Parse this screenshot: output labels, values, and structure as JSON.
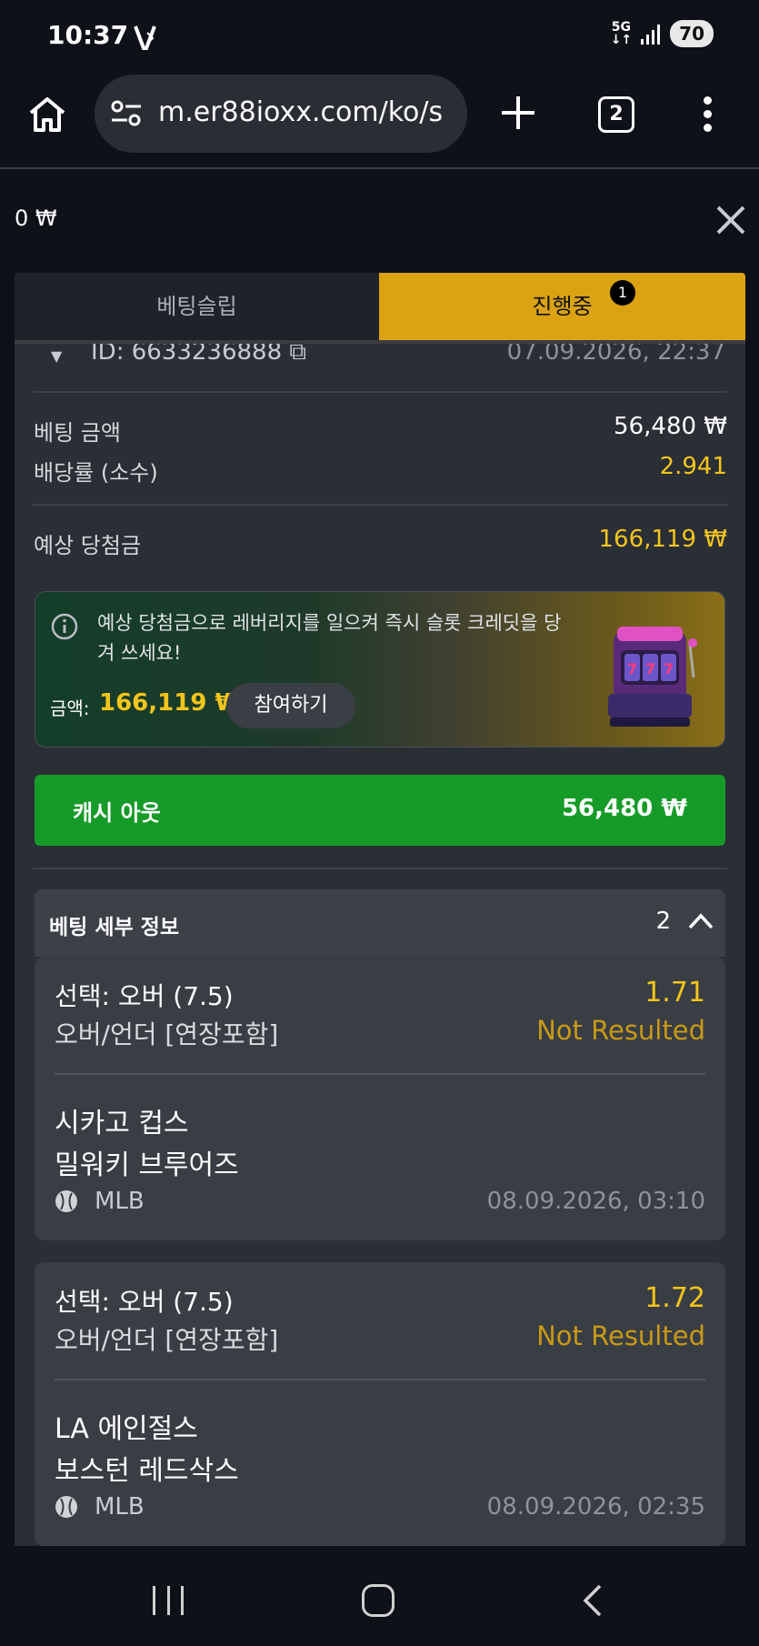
{
  "status_bar": {
    "time": "10:37",
    "network": "5G",
    "battery": "70"
  },
  "browser": {
    "url": "m.er88ioxx.com/ko/s",
    "tab_count": "2"
  },
  "balance": "0 ₩",
  "tabs": {
    "slip": "베팅슬립",
    "active": "진행중",
    "badge": "1"
  },
  "bet": {
    "id": "ID: 6633236888",
    "placed_at": "07.09.2026, 22:37",
    "stake_label": "베팅 금액",
    "stake_value": "56,480 ₩",
    "odds_label": "배당률 (소수)",
    "odds_value": "2.941",
    "payout_label": "예상 당첨금",
    "payout_value": "166,119 ₩"
  },
  "promo": {
    "text": "예상 당첨금으로 레버리지를 일으켜 즉시 슬롯 크레딧을 당겨 쓰세요!",
    "amount_label": "금액:",
    "amount_value": "166,119 ₩",
    "join_label": "참여하기"
  },
  "cashout": {
    "label": "캐시 아웃",
    "amount": "56,480 ₩"
  },
  "details": {
    "title": "베팅 세부 정보",
    "count": "2",
    "selections": [
      {
        "selection": "선택: 오버 (7.5)",
        "odds": "1.71",
        "market": "오버/언더 [연장포함]",
        "status": "Not Resulted",
        "team_home": "시카고 컵스",
        "team_away": "밀워키 브루어즈",
        "league": "MLB",
        "date": "08.09.2026, 03:10"
      },
      {
        "selection": "선택: 오버 (7.5)",
        "odds": "1.72",
        "market": "오버/언더 [연장포함]",
        "status": "Not Resulted",
        "team_home": "LA 에인절스",
        "team_away": "보스턴 레드삭스",
        "league": "MLB",
        "date": "08.09.2026, 02:35"
      }
    ]
  },
  "colors": {
    "accent_yellow": "#dba312",
    "cashout_green": "#169b29",
    "odds_yellow": "#f2c51b",
    "panel_bg": "#2a2e35"
  },
  "icons": [
    "home-icon",
    "tune-icon",
    "plus-icon",
    "tabs-icon",
    "more-icon",
    "close-icon",
    "info-icon",
    "slot-machine-icon",
    "chevron-up-icon",
    "baseball-icon",
    "copy-icon"
  ]
}
